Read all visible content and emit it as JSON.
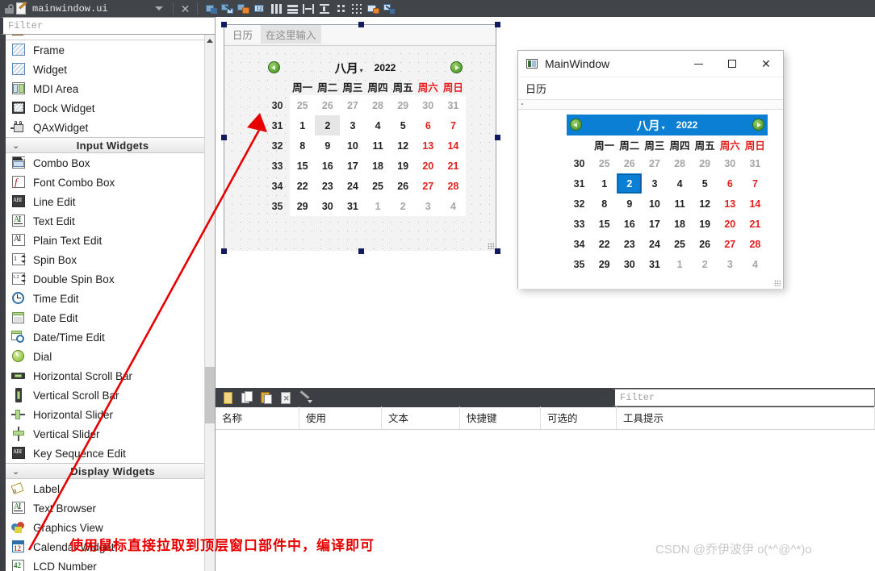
{
  "topbar": {
    "lock_icon": "unlock-icon",
    "doc_icon": "document-edit-icon",
    "file_title": "mainwindow.ui",
    "dropdown_icon": "chevron-down-icon",
    "close_icon": "close-icon",
    "tool_icons": [
      "edit-widgets-icon",
      "edit-signals-slots-icon",
      "edit-buddies-icon",
      "edit-tab-order-icon",
      "layout-horizontal-icon",
      "layout-vertical-icon",
      "layout-splitter-horizontal-icon",
      "layout-splitter-vertical-icon",
      "layout-form-icon",
      "layout-grid-icon",
      "adjust-size-icon",
      "break-layout-icon"
    ]
  },
  "widgetbox": {
    "filter": {
      "placeholder": "Filter"
    },
    "groups": [
      {
        "label": "",
        "collapsed": false,
        "items": [
          {
            "label": "Frame",
            "icon": "frame-icon"
          },
          {
            "label": "Widget",
            "icon": "widget-icon"
          },
          {
            "label": "MDI Area",
            "icon": "mdi-area-icon"
          },
          {
            "label": "Dock Widget",
            "icon": "dock-widget-icon"
          },
          {
            "label": "QAxWidget",
            "icon": "qaxwidget-icon"
          }
        ]
      },
      {
        "label": "Input Widgets",
        "collapsed": false,
        "items": [
          {
            "label": "Combo Box",
            "icon": "combo-box-icon"
          },
          {
            "label": "Font Combo Box",
            "icon": "font-combo-box-icon"
          },
          {
            "label": "Line Edit",
            "icon": "line-edit-icon"
          },
          {
            "label": "Text Edit",
            "icon": "text-edit-icon"
          },
          {
            "label": "Plain Text Edit",
            "icon": "plain-text-edit-icon"
          },
          {
            "label": "Spin Box",
            "icon": "spin-box-icon"
          },
          {
            "label": "Double Spin Box",
            "icon": "double-spin-box-icon"
          },
          {
            "label": "Time Edit",
            "icon": "time-edit-icon"
          },
          {
            "label": "Date Edit",
            "icon": "date-edit-icon"
          },
          {
            "label": "Date/Time Edit",
            "icon": "date-time-edit-icon"
          },
          {
            "label": "Dial",
            "icon": "dial-icon"
          },
          {
            "label": "Horizontal Scroll Bar",
            "icon": "horizontal-scroll-bar-icon"
          },
          {
            "label": "Vertical Scroll Bar",
            "icon": "vertical-scroll-bar-icon"
          },
          {
            "label": "Horizontal Slider",
            "icon": "horizontal-slider-icon"
          },
          {
            "label": "Vertical Slider",
            "icon": "vertical-slider-icon"
          },
          {
            "label": "Key Sequence Edit",
            "icon": "key-sequence-edit-icon"
          }
        ]
      },
      {
        "label": "Display Widgets",
        "collapsed": false,
        "items": [
          {
            "label": "Label",
            "icon": "label-icon"
          },
          {
            "label": "Text Browser",
            "icon": "text-browser-icon"
          },
          {
            "label": "Graphics View",
            "icon": "graphics-view-icon"
          },
          {
            "label": "Calendar Widget",
            "icon": "calendar-widget-icon"
          },
          {
            "label": "LCD Number",
            "icon": "lcd-number-icon"
          }
        ]
      }
    ]
  },
  "form": {
    "menu_items": [
      "日历"
    ],
    "menu_placeholder": "在这里输入"
  },
  "calendar": {
    "prev_icon": "arrow-left-icon",
    "next_icon": "arrow-right-icon",
    "month": "八月",
    "month_caret": "▾",
    "year": "2022",
    "weekday_headers": [
      "周一",
      "周二",
      "周三",
      "周四",
      "周五",
      "周六",
      "周日"
    ],
    "week_numbers": [
      "30",
      "31",
      "32",
      "33",
      "34",
      "35"
    ],
    "rows": [
      [
        {
          "d": "25",
          "t": "out"
        },
        {
          "d": "26",
          "t": "out"
        },
        {
          "d": "27",
          "t": "out"
        },
        {
          "d": "28",
          "t": "out"
        },
        {
          "d": "29",
          "t": "out"
        },
        {
          "d": "30",
          "t": "out"
        },
        {
          "d": "31",
          "t": "out"
        }
      ],
      [
        {
          "d": "1",
          "t": "in"
        },
        {
          "d": "2",
          "t": "sel"
        },
        {
          "d": "3",
          "t": "in"
        },
        {
          "d": "4",
          "t": "in"
        },
        {
          "d": "5",
          "t": "in"
        },
        {
          "d": "6",
          "t": "we"
        },
        {
          "d": "7",
          "t": "we"
        }
      ],
      [
        {
          "d": "8",
          "t": "in"
        },
        {
          "d": "9",
          "t": "in"
        },
        {
          "d": "10",
          "t": "in"
        },
        {
          "d": "11",
          "t": "in"
        },
        {
          "d": "12",
          "t": "in"
        },
        {
          "d": "13",
          "t": "we"
        },
        {
          "d": "14",
          "t": "we"
        }
      ],
      [
        {
          "d": "15",
          "t": "in"
        },
        {
          "d": "16",
          "t": "in"
        },
        {
          "d": "17",
          "t": "in"
        },
        {
          "d": "18",
          "t": "in"
        },
        {
          "d": "19",
          "t": "in"
        },
        {
          "d": "20",
          "t": "we"
        },
        {
          "d": "21",
          "t": "we"
        }
      ],
      [
        {
          "d": "22",
          "t": "in"
        },
        {
          "d": "23",
          "t": "in"
        },
        {
          "d": "24",
          "t": "in"
        },
        {
          "d": "25",
          "t": "in"
        },
        {
          "d": "26",
          "t": "in"
        },
        {
          "d": "27",
          "t": "we"
        },
        {
          "d": "28",
          "t": "we"
        }
      ],
      [
        {
          "d": "29",
          "t": "in"
        },
        {
          "d": "30",
          "t": "in"
        },
        {
          "d": "31",
          "t": "in"
        },
        {
          "d": "1",
          "t": "out"
        },
        {
          "d": "2",
          "t": "out"
        },
        {
          "d": "3",
          "t": "out"
        },
        {
          "d": "4",
          "t": "out"
        }
      ]
    ],
    "selected_day": "2"
  },
  "preview": {
    "app_icon": "app-window-icon",
    "title": "MainWindow",
    "minimize_icon": "minimize-icon",
    "maximize_icon": "maximize-icon",
    "close_icon": "close-icon",
    "menu_items": [
      "日历"
    ]
  },
  "action_editor": {
    "toolbar_icons": [
      "new-action-icon",
      "copy-icon",
      "paste-icon",
      "delete-icon",
      "configure-icon"
    ],
    "filter": {
      "placeholder": "Filter"
    },
    "columns": [
      "名称",
      "使用",
      "文本",
      "快捷键",
      "可选的",
      "工具提示"
    ],
    "rows": []
  },
  "annotations": {
    "arrow_color": "#e60000",
    "note": "使用鼠标直接拉取到顶层窗口部件中，编译即可",
    "watermark": "CSDN @乔伊波伊 o(*^@^*)o"
  },
  "colors": {
    "accent_blue": "#0a7fd4",
    "weekend_red": "#e41f1f",
    "toolbar_dark": "#3c3f43",
    "handle_navy": "#141a62"
  }
}
